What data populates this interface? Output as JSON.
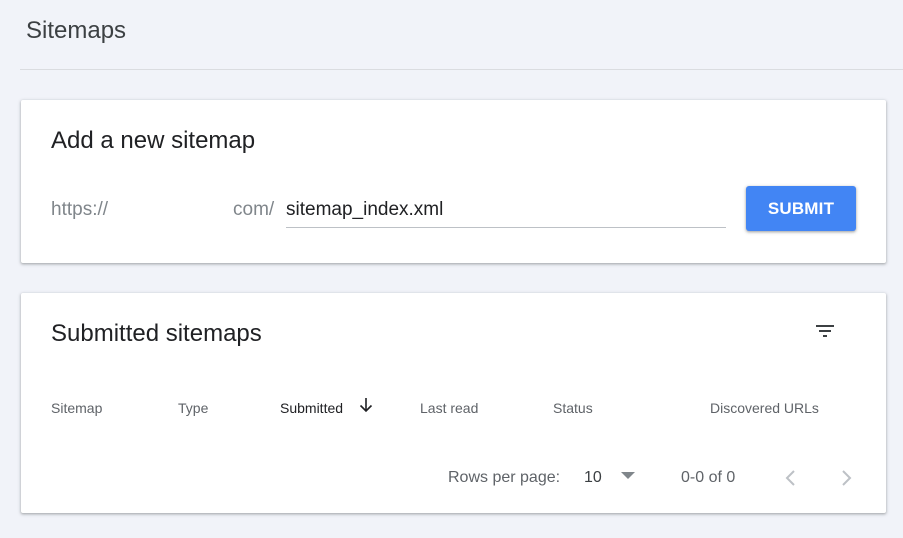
{
  "page": {
    "title": "Sitemaps"
  },
  "add_sitemap": {
    "title": "Add a new sitemap",
    "url_prefix": "https://",
    "url_suffix": "com/",
    "input_value": "sitemap_index.xml",
    "submit_label": "SUBMIT"
  },
  "submitted": {
    "title": "Submitted sitemaps",
    "filter_icon": "filter-icon",
    "columns": [
      "Sitemap",
      "Type",
      "Submitted",
      "Last read",
      "Status",
      "Discovered URLs"
    ],
    "sorted_column": "Submitted",
    "sort_direction": "descending",
    "pagination": {
      "rows_label": "Rows per page:",
      "rows_value": "10",
      "range": "0-0 of 0"
    }
  },
  "colors": {
    "accent": "#4285f4",
    "background": "#f1f3f9"
  }
}
